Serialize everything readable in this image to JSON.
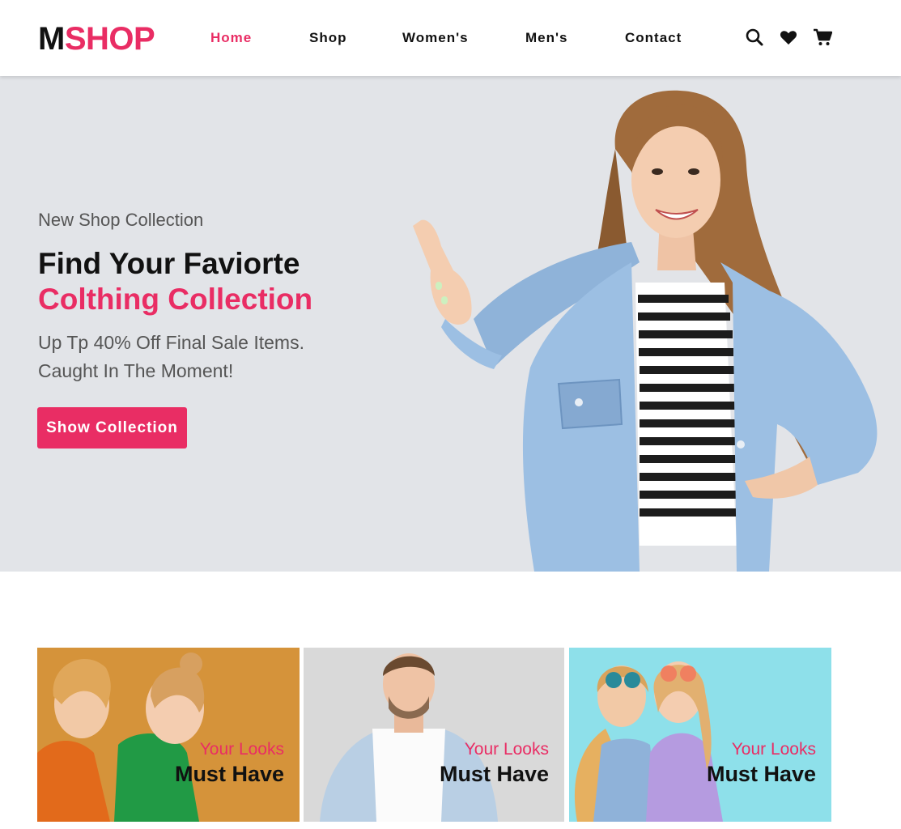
{
  "brand": {
    "logo_m": "M",
    "logo_shop": "SHOP",
    "accent": "#e92d64"
  },
  "nav": {
    "items": [
      {
        "label": "Home",
        "active": true
      },
      {
        "label": "Shop"
      },
      {
        "label": "Women's"
      },
      {
        "label": "Men's"
      },
      {
        "label": "Contact"
      }
    ],
    "icons": [
      "search-icon",
      "heart-icon",
      "cart-icon"
    ]
  },
  "hero": {
    "subtitle": "New Shop Collection",
    "title_line1": "Find Your Faviorte",
    "title_line2": "Colthing Collection",
    "desc_line1": "Up Tp 40% Off Final Sale Items.",
    "desc_line2": "Caught In The Moment!",
    "button": "Show Collection",
    "background": "#e2e4e8"
  },
  "cards": [
    {
      "line1": "Your Looks",
      "line2": "Must Have",
      "background": "#d08a2c"
    },
    {
      "line1": "Your Looks",
      "line2": "Must Have",
      "background": "#dcdcdc"
    },
    {
      "line1": "Your Looks",
      "line2": "Must Have",
      "background": "#8fe1ea"
    }
  ]
}
